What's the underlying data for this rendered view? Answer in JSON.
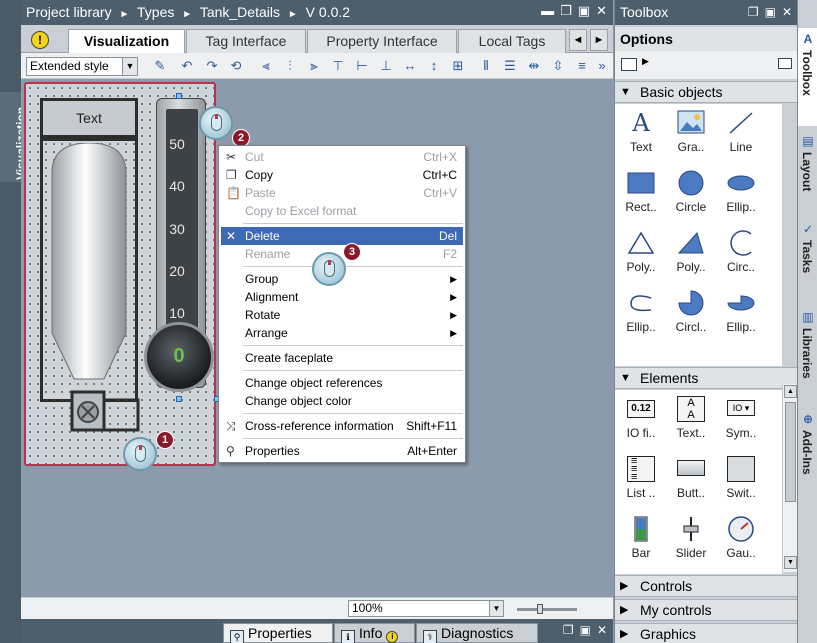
{
  "editor": {
    "breadcrumb": [
      "Project library",
      "Types",
      "Tank_Details",
      "V 0.0.2"
    ],
    "breadcrumb_sep": "►",
    "tabs": [
      "Visualization",
      "Tag Interface",
      "Property Interface",
      "Local Tags"
    ],
    "active_tab": "Visualization",
    "side_label": "Visualization",
    "style_select": "Extended style",
    "warning_symbol": "!"
  },
  "faceplate": {
    "text_label": "Text",
    "scale_ticks": [
      "50",
      "40",
      "30",
      "20",
      "10"
    ],
    "gauge_value": "0"
  },
  "markers": [
    "1",
    "2",
    "3"
  ],
  "context_menu": {
    "items": [
      {
        "label": "Cut",
        "shortcut": "Ctrl+X",
        "icon": "cut-icon",
        "disabled": true
      },
      {
        "label": "Copy",
        "shortcut": "Ctrl+C",
        "icon": "copy-icon",
        "disabled": false
      },
      {
        "label": "Paste",
        "shortcut": "Ctrl+V",
        "icon": "paste-icon",
        "disabled": true
      },
      {
        "label": "Copy to Excel format",
        "shortcut": "",
        "icon": "",
        "disabled": true
      },
      {
        "label": "Delete",
        "shortcut": "Del",
        "icon": "delete-icon",
        "disabled": false,
        "selected": true
      },
      {
        "label": "Rename",
        "shortcut": "F2",
        "icon": "",
        "disabled": true
      },
      {
        "label": "Group",
        "shortcut": "",
        "submenu": true
      },
      {
        "label": "Alignment",
        "shortcut": "",
        "submenu": true
      },
      {
        "label": "Rotate",
        "shortcut": "",
        "submenu": true
      },
      {
        "label": "Arrange",
        "shortcut": "",
        "submenu": true
      },
      {
        "label": "Create faceplate",
        "shortcut": ""
      },
      {
        "label": "Change object references",
        "shortcut": ""
      },
      {
        "label": "Change object color",
        "shortcut": ""
      },
      {
        "label": "Cross-reference information",
        "shortcut": "Shift+F11",
        "icon": "cross-ref-icon"
      },
      {
        "label": "Properties",
        "shortcut": "Alt+Enter",
        "icon": "properties-icon"
      }
    ]
  },
  "status": {
    "zoom": "100%"
  },
  "inspector": {
    "tabs": [
      "Properties",
      "Info",
      "Diagnostics"
    ],
    "active": "Properties",
    "info_icon": "i"
  },
  "toolbox": {
    "title": "Toolbox",
    "options_label": "Options",
    "basic_objects": {
      "title": "Basic objects",
      "items": [
        "Text",
        "Gra..",
        "Line",
        "Rect..",
        "Circle",
        "Ellip..",
        "Poly..",
        "Poly..",
        "Circ..",
        "Ellip..",
        "Circl..",
        "Ellip.."
      ]
    },
    "elements": {
      "title": "Elements",
      "items": [
        "IO fi..",
        "Text..",
        "Sym..",
        "List ..",
        "Butt..",
        "Swit..",
        "Bar",
        "Slider",
        "Gau.."
      ],
      "io_field_text": "0.12"
    },
    "controls_title": "Controls",
    "my_controls_title": "My controls",
    "graphics_title": "Graphics",
    "text_glyph": "A"
  },
  "right_tabs": [
    "Toolbox",
    "Layout",
    "Tasks",
    "Libraries",
    "Add-Ins"
  ],
  "colors": {
    "selection": "#3c6ab4",
    "faceplate_border": "#b5354f",
    "badge": "#8a1a2a",
    "gauge_value": "#6cc04a"
  }
}
